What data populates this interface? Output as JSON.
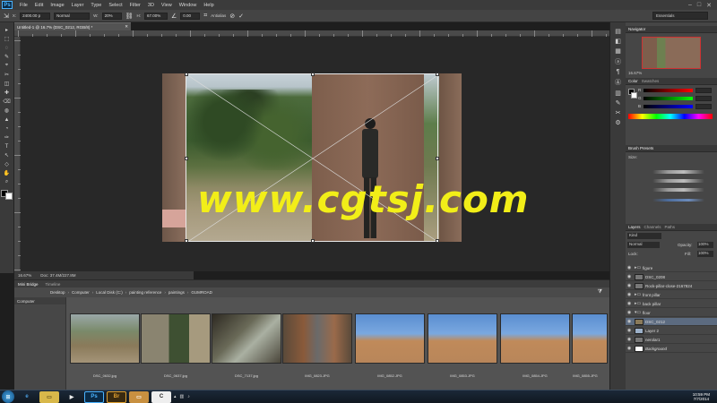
{
  "menubar": {
    "logo": "Ps",
    "items": [
      "File",
      "Edit",
      "Image",
      "Layer",
      "Type",
      "Select",
      "Filter",
      "3D",
      "View",
      "Window",
      "Help"
    ],
    "minimize": "–",
    "maximize": "□",
    "close": "✕"
  },
  "options": {
    "x_value": "2400.00 p",
    "mode": "Normal",
    "w_value": "20%",
    "h_value": "67.00%",
    "angle_value": "0.00",
    "antialias_label": "Antialias",
    "cancel_icon": "⊘",
    "commit_icon": "✓",
    "workspace": "Essentials"
  },
  "document": {
    "tab_label": "Untitled-1 @ 16.7% (DSC_0212, RGB/8) *",
    "tab_close": "✕",
    "zoom": "16.67%",
    "doc_info": "Doc: 37.4M/227.8M"
  },
  "watermark": "www.cgtsj.com",
  "tools": [
    "▸",
    "⬚",
    "◌",
    "✎",
    "⌖",
    "✂",
    "◫",
    "✚",
    "⌫",
    "◍",
    "▲",
    "◔",
    "✑",
    "T",
    "↖",
    "◇",
    "✋",
    "⌕"
  ],
  "dock_icons": [
    "▤",
    "◧",
    "▦",
    "ⓐ",
    "¶",
    "Ⓐ",
    "▥",
    "✎",
    "✂",
    "⚙"
  ],
  "navigator": {
    "tabs": [
      "Navigator"
    ],
    "zoom": "16.67%"
  },
  "color": {
    "tabs": [
      "Color",
      "Swatches"
    ],
    "r_label": "R",
    "g_label": "G",
    "b_label": "B",
    "r_value": "",
    "g_value": "",
    "b_value": ""
  },
  "brush": {
    "tabs": [
      "Brush Presets"
    ],
    "size_label": "Size:"
  },
  "layers": {
    "tabs": [
      "Layers",
      "Channels",
      "Paths"
    ],
    "filter_label": "Kind",
    "blend_mode": "Normal",
    "opacity_label": "Opacity:",
    "opacity_value": "100%",
    "lock_label": "Lock:",
    "fill_label": "Fill:",
    "fill_value": "100%",
    "rows": [
      {
        "name": "figure",
        "kind": "folder"
      },
      {
        "name": "DSC_0208",
        "kind": "layer"
      },
      {
        "name": "Rock-pillar-close-2167824",
        "kind": "layer"
      },
      {
        "name": "front pillar",
        "kind": "folder"
      },
      {
        "name": "back pillar",
        "kind": "folder"
      },
      {
        "name": "floor",
        "kind": "folder"
      },
      {
        "name": "DSC_0212",
        "kind": "layer",
        "selected": true
      },
      {
        "name": "Layer 2",
        "kind": "layer"
      },
      {
        "name": "nerolar1",
        "kind": "layer"
      },
      {
        "name": "Background",
        "kind": "layer"
      }
    ]
  },
  "minibridge": {
    "tabs": [
      "Mini Bridge",
      "Timeline"
    ],
    "breadcrumbs": [
      "Desktop",
      "Computer",
      "Local Disk (C:)",
      "painting reference",
      "paintings",
      "GUMROAD"
    ],
    "side_label": "Computer",
    "thumbs": [
      {
        "caption": "DSC_0632.jpg"
      },
      {
        "caption": "DSC_0637.jpg"
      },
      {
        "caption": "DSC_7137.jpg"
      },
      {
        "caption": "IMG_0823.JPG"
      },
      {
        "caption": "IMG_0852.JPG"
      },
      {
        "caption": "IMG_0853.JPG"
      },
      {
        "caption": "IMG_0854.JPG"
      },
      {
        "caption": "IMG_0855.JPG"
      }
    ]
  },
  "taskbar": {
    "apps": [
      "Ps",
      "Br",
      "C"
    ],
    "time": "10:59 PM",
    "date": "7/7/2014"
  },
  "colors": {
    "accent": "#4ab3ff",
    "selected_layer": "#5c6b80",
    "watermark": "#f2ee18"
  }
}
